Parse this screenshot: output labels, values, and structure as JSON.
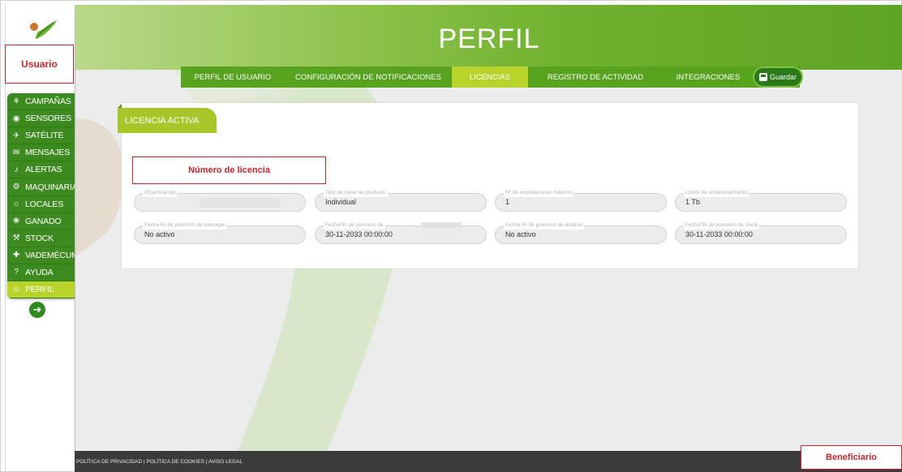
{
  "annotations": {
    "usuario": "Usuario",
    "numero_licencia": "Número de licencia",
    "beneficiario": "Beneficiario"
  },
  "header": {
    "title": "PERFIL"
  },
  "sidebar": {
    "items": [
      {
        "label": "CAMPAÑAS",
        "icon": "plant-icon",
        "active": false
      },
      {
        "label": "SENSORES",
        "icon": "signal-icon",
        "active": false
      },
      {
        "label": "SATÉLITE",
        "icon": "satellite-icon",
        "active": false
      },
      {
        "label": "MENSAJES",
        "icon": "envelope-icon",
        "active": false
      },
      {
        "label": "ALERTAS",
        "icon": "bell-icon",
        "active": false
      },
      {
        "label": "MAQUINARIA",
        "icon": "tractor-icon",
        "active": false
      },
      {
        "label": "LOCALES",
        "icon": "building-icon",
        "active": false
      },
      {
        "label": "GANADO",
        "icon": "cow-icon",
        "active": false
      },
      {
        "label": "STOCK",
        "icon": "tools-icon",
        "active": false
      },
      {
        "label": "VADEMÉCUM",
        "icon": "medkit-icon",
        "active": false
      },
      {
        "label": "AYUDA",
        "icon": "question-icon",
        "active": false
      },
      {
        "label": "PERFIL",
        "icon": "user-circle-icon",
        "active": true
      }
    ]
  },
  "tabs": [
    {
      "label": "PERFIL DE USUARIO",
      "active": false
    },
    {
      "label": "CONFIGURACIÓN DE NOTIFICACIONES",
      "active": false
    },
    {
      "label": "LICENCIAS",
      "active": true
    },
    {
      "label": "REGISTRO DE ACTIVIDAD",
      "active": false
    },
    {
      "label": "INTEGRACIONES",
      "active": false
    }
  ],
  "save_label": "Guardar",
  "card": {
    "title": "LICENCIA ACTIVA",
    "fields": [
      {
        "label": "Organización",
        "value": ""
      },
      {
        "label": "Tipo de clave de producto",
        "value": "Individual"
      },
      {
        "label": "Nº de explotaciones máximo",
        "value": "1"
      },
      {
        "label": "Límite de almacenamiento",
        "value": "1 Tb"
      },
      {
        "label": "Fecha fin de premium de mánager",
        "value": "No activo"
      },
      {
        "label": "Fecha fin de premium de",
        "value": "30-11-2033 00:00:00"
      },
      {
        "label": "Fecha fin de premium de análisis",
        "value": "No activo"
      },
      {
        "label": "Fecha fin de premium de stock",
        "value": "30-11-2033 00:00:00"
      }
    ]
  },
  "footer": {
    "links": "POLÍTICA DE PRIVACIDAD | POLÍTICA DE COOKIES | AVISO LEGAL"
  },
  "colors": {
    "menu_green": "#3d8b20",
    "active_lime": "#b9d32b",
    "annotation_red": "#c0262b"
  }
}
